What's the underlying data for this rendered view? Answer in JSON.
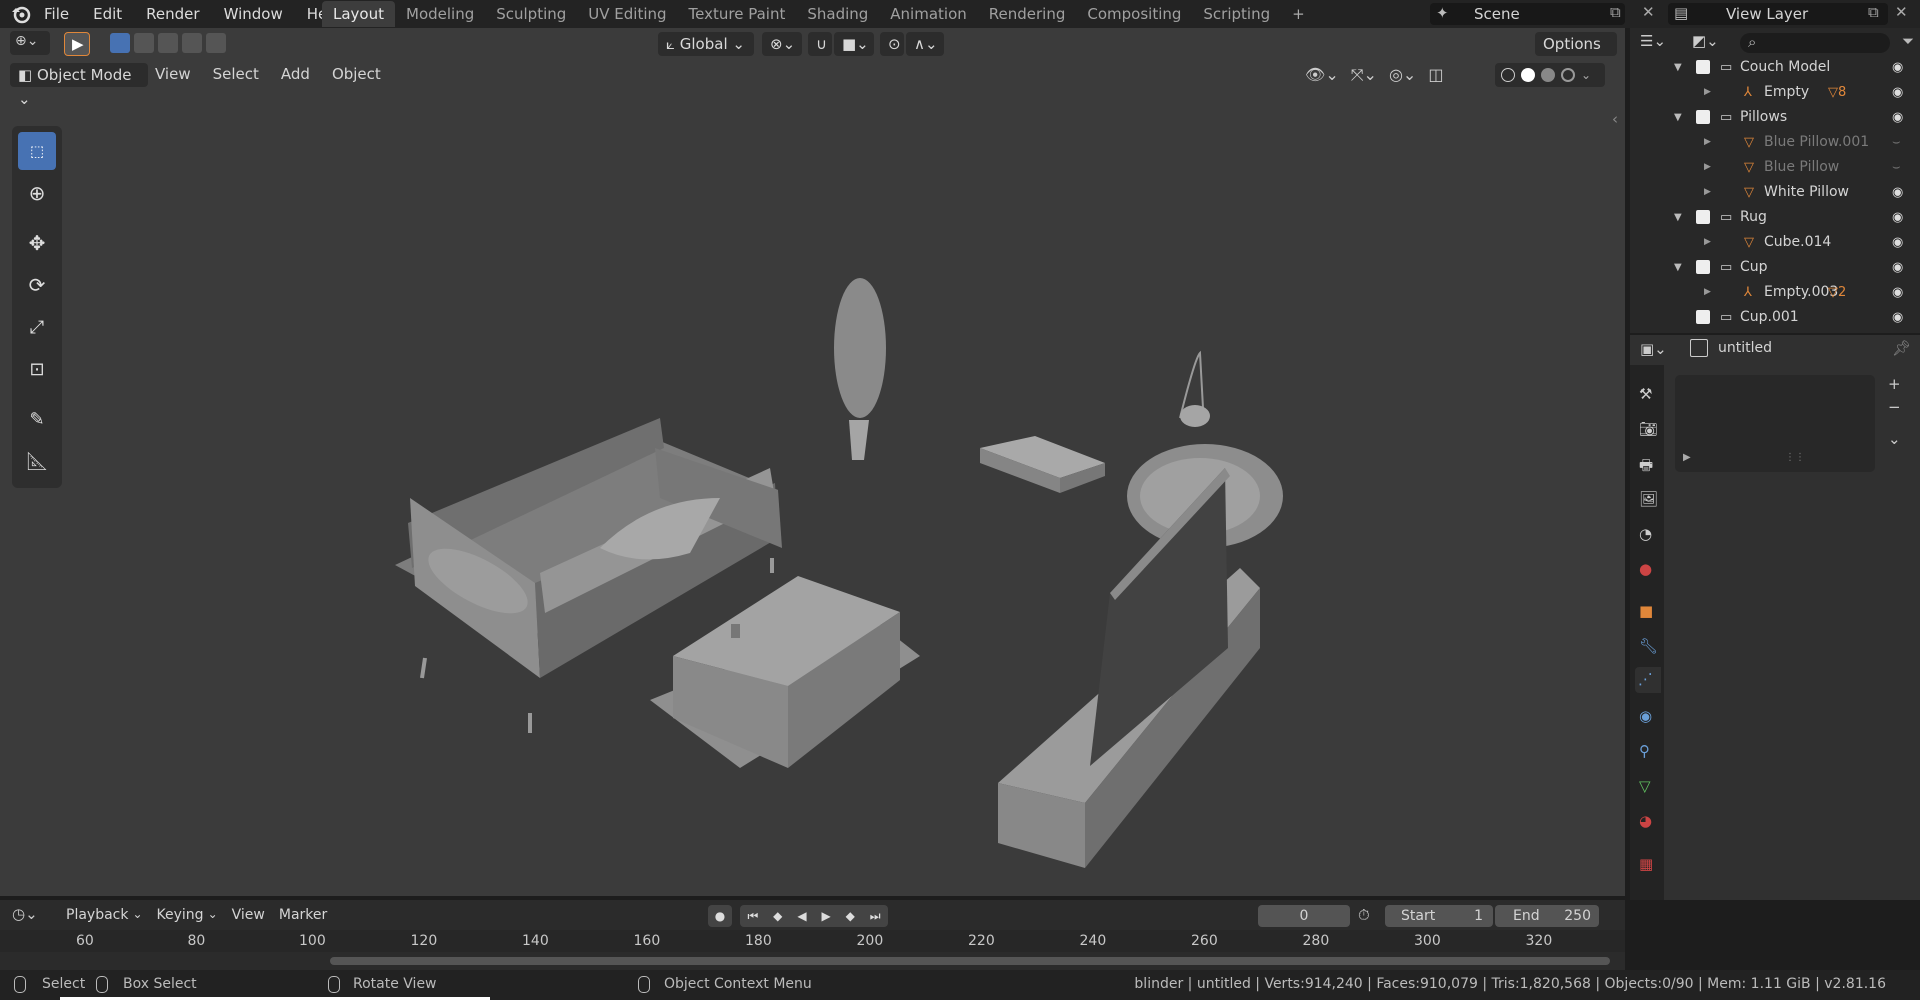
{
  "app_menu": [
    "File",
    "Edit",
    "Render",
    "Window",
    "Help"
  ],
  "workspaces": [
    "Layout",
    "Modeling",
    "Sculpting",
    "UV Editing",
    "Texture Paint",
    "Shading",
    "Animation",
    "Rendering",
    "Compositing",
    "Scripting"
  ],
  "active_workspace": "Layout",
  "scene_label": "Scene",
  "view_layer_label": "View Layer",
  "viewport": {
    "transform_orientation": "Global",
    "options_label": "Options",
    "mode": "Object Mode",
    "menus": [
      "View",
      "Select",
      "Add",
      "Object"
    ]
  },
  "outliner": {
    "rows": [
      {
        "label": "Couch Model",
        "type": "collection",
        "level": 0,
        "expanded": true
      },
      {
        "label": "Empty",
        "type": "empty",
        "level": 1,
        "badge": "8"
      },
      {
        "label": "Pillows",
        "type": "collection",
        "level": 0,
        "expanded": true
      },
      {
        "label": "Blue Pillow.001",
        "type": "mesh",
        "level": 1,
        "dim": true
      },
      {
        "label": "Blue Pillow",
        "type": "mesh",
        "level": 1,
        "dim": true
      },
      {
        "label": "White Pillow",
        "type": "mesh",
        "level": 1
      },
      {
        "label": "Rug",
        "type": "collection",
        "level": 0,
        "expanded": true
      },
      {
        "label": "Cube.014",
        "type": "mesh",
        "level": 1
      },
      {
        "label": "Cup",
        "type": "collection",
        "level": 0,
        "expanded": true
      },
      {
        "label": "Empty.003",
        "type": "empty",
        "level": 1,
        "badge": "2"
      },
      {
        "label": "Cup.001",
        "type": "collection",
        "level": 0
      }
    ]
  },
  "properties": {
    "datablock_name": "untitled"
  },
  "timeline": {
    "menus": [
      "Playback",
      "Keying",
      "View",
      "Marker"
    ],
    "current_frame": "0",
    "start_label": "Start",
    "start_value": "1",
    "end_label": "End",
    "end_value": "250",
    "ruler": [
      "60",
      "80",
      "100",
      "120",
      "140",
      "160",
      "180",
      "200",
      "220",
      "240",
      "260",
      "280",
      "300",
      "320"
    ]
  },
  "status": {
    "select": "Select",
    "box_select": "Box Select",
    "rotate_view": "Rotate View",
    "context_menu": "Object Context Menu",
    "stats": "blinder | untitled | Verts:914,240 | Faces:910,079 | Tris:1,820,568 | Objects:0/90 | Mem: 1.11 GiB | v2.81.16"
  },
  "colors": {
    "accent": "#4772b3",
    "orange": "#e0873a",
    "mesh_gray": "#8a8a8a"
  }
}
